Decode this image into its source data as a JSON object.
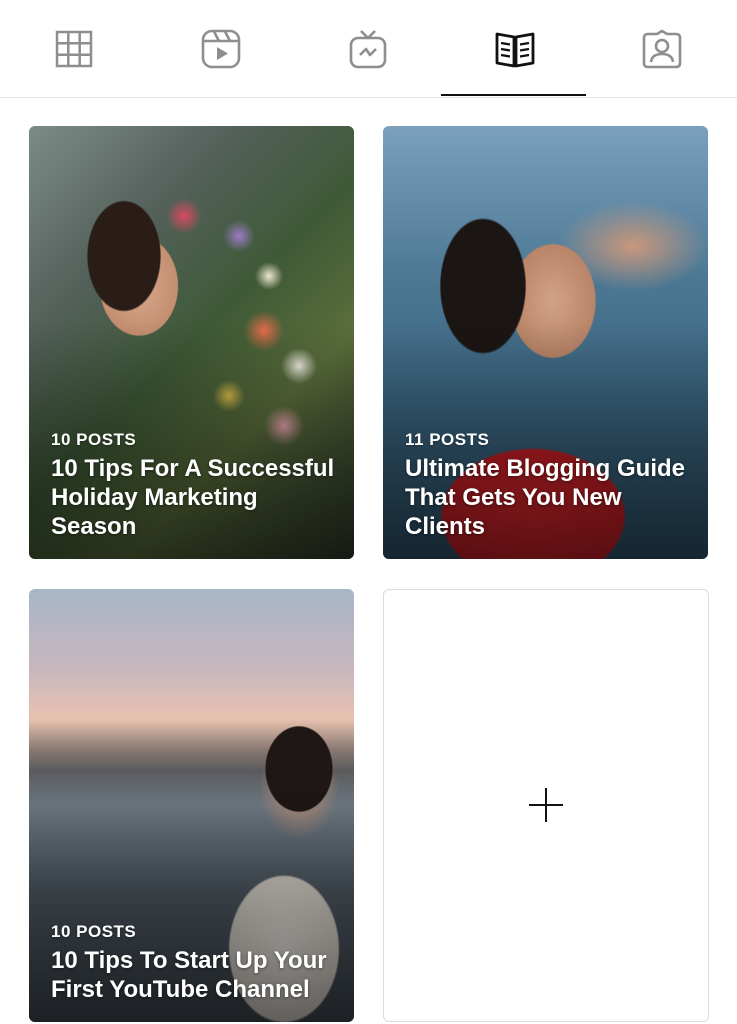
{
  "tabs": [
    {
      "name": "grid-icon",
      "active": false
    },
    {
      "name": "reels-icon",
      "active": false
    },
    {
      "name": "igtv-icon",
      "active": false
    },
    {
      "name": "guides-icon",
      "active": true
    },
    {
      "name": "tagged-icon",
      "active": false
    }
  ],
  "guides": [
    {
      "count": "10 POSTS",
      "title": "10 Tips For A Successful Holiday Marketing Season"
    },
    {
      "count": "11 POSTS",
      "title": "Ultimate Blogging Guide That Gets You New Clients"
    },
    {
      "count": "10 POSTS",
      "title": "10 Tips To Start Up Your First YouTube Channel"
    }
  ],
  "colors": {
    "active_tab": "#111111",
    "inactive_tab": "#8e8e8e",
    "divider": "#e3e3e3"
  }
}
